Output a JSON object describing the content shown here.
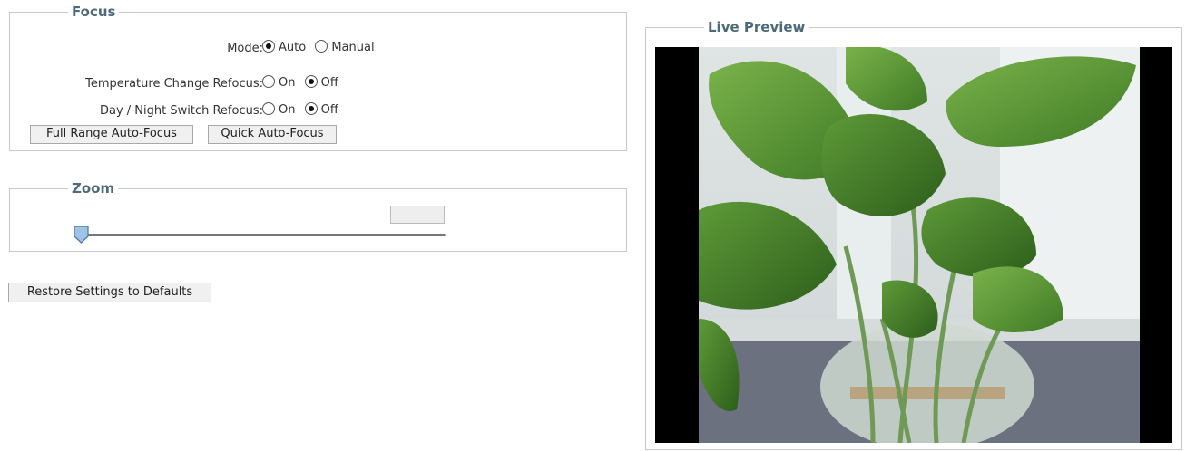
{
  "focus": {
    "legend": "Focus",
    "mode_label": "Mode:",
    "mode_auto": "Auto",
    "mode_manual": "Manual",
    "temp_label": "Temperature Change Refocus:",
    "temp_on": "On",
    "temp_off": "Off",
    "daynight_label": "Day / Night Switch Refocus:",
    "daynight_on": "On",
    "daynight_off": "Off",
    "full_range_button": "Full Range Auto-Focus",
    "quick_button": "Quick Auto-Focus",
    "mode_selected": "Auto",
    "temp_selected": "Off",
    "daynight_selected": "Off"
  },
  "zoom": {
    "legend": "Zoom",
    "value": "",
    "level": 0
  },
  "restore_button": "Restore Settings to Defaults",
  "preview": {
    "legend": "Live Preview"
  }
}
